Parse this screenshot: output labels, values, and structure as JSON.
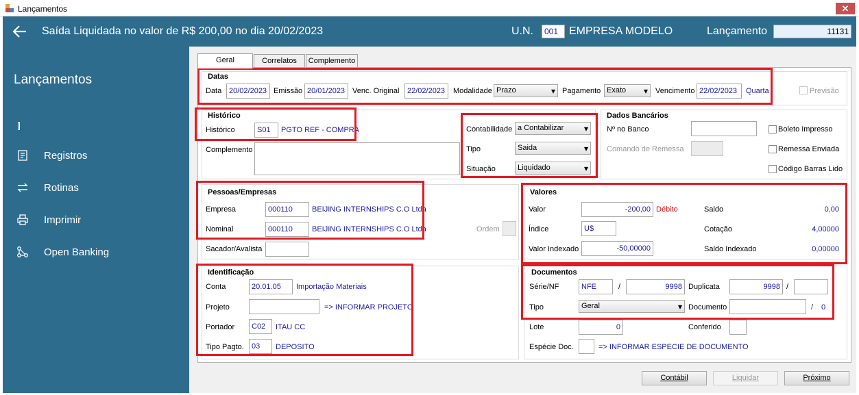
{
  "window": {
    "title": "Lançamentos",
    "close": "✕"
  },
  "header": {
    "title": "Saída Liquidada no valor de R$ 200,00 no dia 20/02/2023",
    "un_label": "U.N.",
    "un_code": "001",
    "company": "EMPRESA MODELO",
    "lanc_label": "Lançamento",
    "lanc_value": "11131"
  },
  "sidebar": {
    "title": "Lançamentos",
    "items": [
      {
        "label": "Registros"
      },
      {
        "label": "Rotinas"
      },
      {
        "label": "Imprimir"
      },
      {
        "label": "Open Banking"
      }
    ]
  },
  "tabs": [
    "Geral",
    "Correlatos",
    "Complemento"
  ],
  "datas": {
    "title": "Datas",
    "data_label": "Data",
    "data": "20/02/2023",
    "emissao_label": "Emissão",
    "emissao": "20/01/2023",
    "venc_orig_label": "Venc. Original",
    "venc_orig": "22/02/2023",
    "modalidade_label": "Modalidade",
    "modalidade": "Prazo",
    "pagamento_label": "Pagamento",
    "pagamento": "Exato",
    "vencimento_label": "Vencimento",
    "vencimento": "22/02/2023",
    "weekday": "Quarta",
    "previsao_label": "Previsão"
  },
  "historico": {
    "title": "Histórico",
    "hist_label": "Histórico",
    "hist_code": "S01",
    "hist_desc": "PGTO REF - COMPRA",
    "complemento_label": "Complemento"
  },
  "classif": {
    "contab_label": "Contabilidade",
    "contab": "a Contabilizar",
    "tipo_label": "Tipo",
    "tipo": "Saida",
    "situacao_label": "Situação",
    "situacao": "Liquidado"
  },
  "banco": {
    "title": "Dados Bancários",
    "nro_label": "Nº no Banco",
    "remessa_label": "Comando de Remessa",
    "boleto_label": "Boleto Impresso",
    "remessa_env_label": "Remessa Enviada",
    "codbarras_label": "Código Barras Lido"
  },
  "pessoas": {
    "title": "Pessoas/Empresas",
    "empresa_label": "Empresa",
    "empresa_code": "000110",
    "empresa_name": "BEIJING INTERNSHIPS C.O Ltda",
    "nominal_label": "Nominal",
    "nominal_code": "000110",
    "nominal_name": "BEIJING INTERNSHIPS C.O Ltda",
    "ordem_label": "Ordem",
    "sacador_label": "Sacador/Avalista"
  },
  "valores": {
    "title": "Valores",
    "valor_label": "Valor",
    "valor": "-200,00",
    "debito": "Débito",
    "saldo_label": "Saldo",
    "saldo": "0,00",
    "indice_label": "Índice",
    "indice": "U$",
    "cotacao_label": "Cotação",
    "cotacao": "4,00000",
    "vi_label": "Valor Indexado",
    "vi": "-50,00000",
    "si_label": "Saldo Indexado",
    "si": "0,00000"
  },
  "ident": {
    "title": "Identificação",
    "conta_label": "Conta",
    "conta_code": "20.01.05",
    "conta_name": "Importação Materiais",
    "projeto_label": "Projeto",
    "projeto_hint": "=> INFORMAR PROJETO",
    "portador_label": "Portador",
    "portador_code": "C02",
    "portador_name": "ITAU CC",
    "tipopag_label": "Tipo Pagto.",
    "tipopag_code": "03",
    "tipopag_name": "DEPOSITO"
  },
  "docs": {
    "title": "Documentos",
    "serie_label": "Série/NF",
    "serie": "NFE",
    "slash": "/",
    "nf": "9998",
    "duplicata_label": "Duplicata",
    "duplicata": "9998",
    "tipo_label": "Tipo",
    "tipo": "Geral",
    "documento_label": "Documento",
    "doc_count": "0",
    "lote_label": "Lote",
    "lote": "0",
    "conferido_label": "Conferido",
    "especie_label": "Espécie Doc.",
    "especie_hint": "=> INFORMAR ESPECIE DE DOCUMENTO"
  },
  "buttons": {
    "contabil": "Contábil",
    "liquidar": "Liquidar",
    "proximo": "Próximo"
  }
}
